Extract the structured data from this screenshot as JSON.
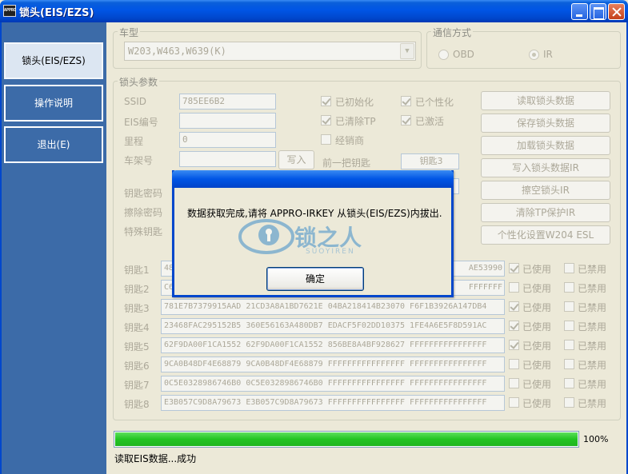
{
  "window": {
    "title": "锁头(EIS/EZS)",
    "app_icon_label": "APPRO"
  },
  "sidebar": {
    "items": [
      {
        "label": "锁头(EIS/EZS)",
        "active": true
      },
      {
        "label": "操作说明"
      },
      {
        "label": "退出(E)"
      }
    ]
  },
  "vehicle": {
    "group_label": "车型",
    "model_value": "W203,W463,W639(K)"
  },
  "comm": {
    "group_label": "通信方式",
    "options": [
      {
        "label": "OBD",
        "selected": false
      },
      {
        "label": "IR",
        "selected": true
      }
    ]
  },
  "params": {
    "group_label": "锁头参数",
    "fields": {
      "ssid": {
        "label": "SSID",
        "value": "785EE6B2"
      },
      "eis_no": {
        "label": "EIS编号",
        "value": ""
      },
      "mileage": {
        "label": "里程",
        "value": "0"
      },
      "vin": {
        "label": "车架号",
        "value": ""
      }
    },
    "write_button": "写入",
    "checks": {
      "initialized": {
        "label": "已初始化",
        "checked": true
      },
      "personalized": {
        "label": "已个性化",
        "checked": true
      },
      "tp_cleared": {
        "label": "已清除TP",
        "checked": true
      },
      "activated": {
        "label": "已激活",
        "checked": true
      },
      "dealer": {
        "label": "经销商",
        "checked": false
      }
    },
    "prev_key_label": "前一把钥匙",
    "prev_key_value": "钥匙3",
    "key_password_label": "钥匙密码",
    "erase_password_label": "擦除密码",
    "special_key_label": "特殊钥匙",
    "buttons": [
      "读取锁头数据",
      "保存锁头数据",
      "加载锁头数据",
      "写入锁头数据IR",
      "擦空锁头IR",
      "清除TP保护IR",
      "个性化设置W204 ESL"
    ]
  },
  "keys": {
    "used_label": "已使用",
    "disabled_label": "已禁用",
    "rows": [
      {
        "label": "钥匙1",
        "value": "48",
        "value_tail": "AE53990",
        "used": true,
        "disabled": false
      },
      {
        "label": "钥匙2",
        "value": "C6",
        "value_tail": "FFFFFFF",
        "used": false,
        "disabled": false
      },
      {
        "label": "钥匙3",
        "value": "781E7B7379915AAD 21CD3A8A1BD7621E 04BA218414B23070 F6F1B3926A147DB4",
        "used": true,
        "disabled": false
      },
      {
        "label": "钥匙4",
        "value": "23468FAC295152B5 360E56163A480DB7 EDACF5F02DD10375 1FE4A6E5F8D591AC",
        "used": true,
        "disabled": false
      },
      {
        "label": "钥匙5",
        "value": "62F9DA00F1CA1552 62F9DA00F1CA1552 856BE8A4BF928627 FFFFFFFFFFFFFFFF",
        "used": true,
        "disabled": false
      },
      {
        "label": "钥匙6",
        "value": "9CA0B48DF4E68879 9CA0B48DF4E68879 FFFFFFFFFFFFFFFF FFFFFFFFFFFFFFFF",
        "used": false,
        "disabled": false
      },
      {
        "label": "钥匙7",
        "value": "0C5E0328986746B0 0C5E0328986746B0 FFFFFFFFFFFFFFFF FFFFFFFFFFFFFFFF",
        "used": false,
        "disabled": false
      },
      {
        "label": "钥匙8",
        "value": "E3B057C9D8A79673 E3B057C9D8A79673 FFFFFFFFFFFFFFFF FFFFFFFFFFFFFFFF",
        "used": false,
        "disabled": false
      }
    ]
  },
  "progress": {
    "percent": 100,
    "percent_label": "100%"
  },
  "status_text": "读取EIS数据...成功",
  "dialog": {
    "message": "数据获取完成,请将 APPRO-IRKEY 从锁头(EIS/EZS)内拔出.",
    "ok_label": "确定"
  },
  "watermark": {
    "text": "锁之人",
    "sub": "SUOYIREN"
  },
  "colors": {
    "accent": "#0055E5",
    "sidebar": "#3C6BA8",
    "progress": "#23C423"
  }
}
